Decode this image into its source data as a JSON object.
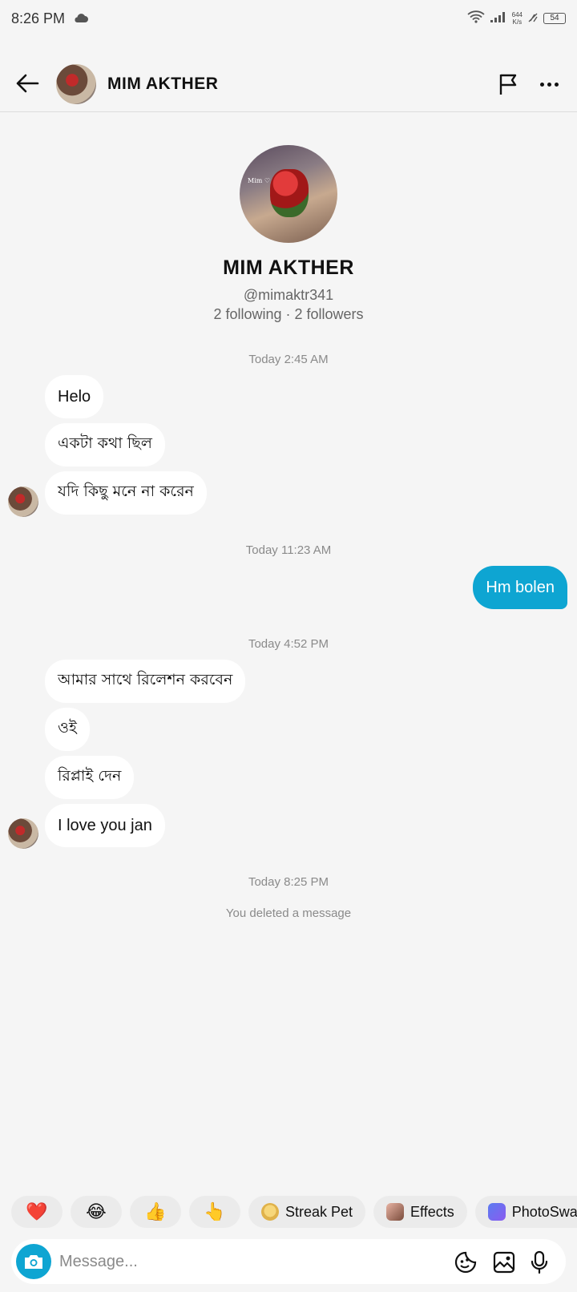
{
  "status_bar": {
    "time": "8:26 PM",
    "net_speed_value": "644",
    "net_speed_unit": "K/s",
    "battery": "54"
  },
  "header": {
    "name": "MIM  AKTHER"
  },
  "profile": {
    "avatar_caption": "Mim ♡",
    "name": "MIM  AKTHER",
    "handle": "@mimaktr341",
    "stats": "2 following · 2 followers"
  },
  "chat": {
    "groups": [
      {
        "time": "Today 2:45 AM",
        "messages": [
          "Helo",
          "একটা কথা ছিল",
          "যদি কিছু মনে না করেন"
        ]
      },
      {
        "time": "Today 11:23 AM",
        "messages": [
          "Hm bolen"
        ]
      },
      {
        "time": "Today 4:52 PM",
        "messages": [
          "আমার সাথে রিলেশন করবেন",
          "ওই",
          "রিপ্লাই দেন",
          "I love you jan"
        ]
      },
      {
        "time": "Today 8:25 PM",
        "note": "You deleted a message"
      }
    ]
  },
  "chips": [
    "❤️",
    "😂",
    "👍",
    "👆",
    "Streak Pet",
    "Effects",
    "PhotoSwap"
  ],
  "composer": {
    "placeholder": "Message..."
  },
  "colors": {
    "accent": "#0ea5d2",
    "background": "#f5f5f5",
    "bubble_incoming": "#ffffff"
  }
}
